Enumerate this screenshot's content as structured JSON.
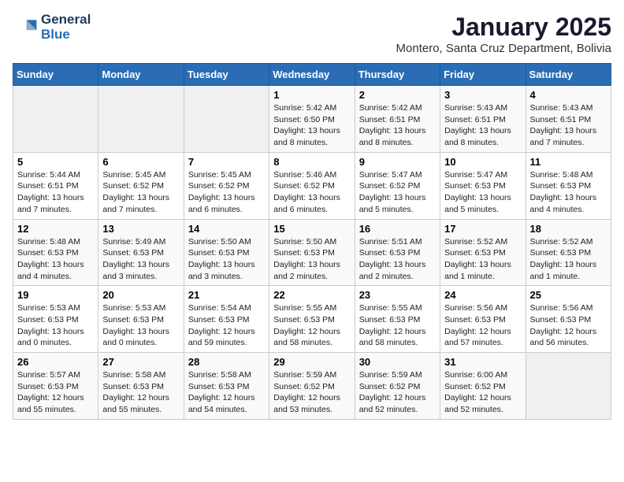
{
  "header": {
    "logo_line1": "General",
    "logo_line2": "Blue",
    "title": "January 2025",
    "subtitle": "Montero, Santa Cruz Department, Bolivia"
  },
  "weekdays": [
    "Sunday",
    "Monday",
    "Tuesday",
    "Wednesday",
    "Thursday",
    "Friday",
    "Saturday"
  ],
  "weeks": [
    [
      {
        "day": "",
        "info": ""
      },
      {
        "day": "",
        "info": ""
      },
      {
        "day": "",
        "info": ""
      },
      {
        "day": "1",
        "info": "Sunrise: 5:42 AM\nSunset: 6:50 PM\nDaylight: 13 hours and 8 minutes."
      },
      {
        "day": "2",
        "info": "Sunrise: 5:42 AM\nSunset: 6:51 PM\nDaylight: 13 hours and 8 minutes."
      },
      {
        "day": "3",
        "info": "Sunrise: 5:43 AM\nSunset: 6:51 PM\nDaylight: 13 hours and 8 minutes."
      },
      {
        "day": "4",
        "info": "Sunrise: 5:43 AM\nSunset: 6:51 PM\nDaylight: 13 hours and 7 minutes."
      }
    ],
    [
      {
        "day": "5",
        "info": "Sunrise: 5:44 AM\nSunset: 6:51 PM\nDaylight: 13 hours and 7 minutes."
      },
      {
        "day": "6",
        "info": "Sunrise: 5:45 AM\nSunset: 6:52 PM\nDaylight: 13 hours and 7 minutes."
      },
      {
        "day": "7",
        "info": "Sunrise: 5:45 AM\nSunset: 6:52 PM\nDaylight: 13 hours and 6 minutes."
      },
      {
        "day": "8",
        "info": "Sunrise: 5:46 AM\nSunset: 6:52 PM\nDaylight: 13 hours and 6 minutes."
      },
      {
        "day": "9",
        "info": "Sunrise: 5:47 AM\nSunset: 6:52 PM\nDaylight: 13 hours and 5 minutes."
      },
      {
        "day": "10",
        "info": "Sunrise: 5:47 AM\nSunset: 6:53 PM\nDaylight: 13 hours and 5 minutes."
      },
      {
        "day": "11",
        "info": "Sunrise: 5:48 AM\nSunset: 6:53 PM\nDaylight: 13 hours and 4 minutes."
      }
    ],
    [
      {
        "day": "12",
        "info": "Sunrise: 5:48 AM\nSunset: 6:53 PM\nDaylight: 13 hours and 4 minutes."
      },
      {
        "day": "13",
        "info": "Sunrise: 5:49 AM\nSunset: 6:53 PM\nDaylight: 13 hours and 3 minutes."
      },
      {
        "day": "14",
        "info": "Sunrise: 5:50 AM\nSunset: 6:53 PM\nDaylight: 13 hours and 3 minutes."
      },
      {
        "day": "15",
        "info": "Sunrise: 5:50 AM\nSunset: 6:53 PM\nDaylight: 13 hours and 2 minutes."
      },
      {
        "day": "16",
        "info": "Sunrise: 5:51 AM\nSunset: 6:53 PM\nDaylight: 13 hours and 2 minutes."
      },
      {
        "day": "17",
        "info": "Sunrise: 5:52 AM\nSunset: 6:53 PM\nDaylight: 13 hours and 1 minute."
      },
      {
        "day": "18",
        "info": "Sunrise: 5:52 AM\nSunset: 6:53 PM\nDaylight: 13 hours and 1 minute."
      }
    ],
    [
      {
        "day": "19",
        "info": "Sunrise: 5:53 AM\nSunset: 6:53 PM\nDaylight: 13 hours and 0 minutes."
      },
      {
        "day": "20",
        "info": "Sunrise: 5:53 AM\nSunset: 6:53 PM\nDaylight: 13 hours and 0 minutes."
      },
      {
        "day": "21",
        "info": "Sunrise: 5:54 AM\nSunset: 6:53 PM\nDaylight: 12 hours and 59 minutes."
      },
      {
        "day": "22",
        "info": "Sunrise: 5:55 AM\nSunset: 6:53 PM\nDaylight: 12 hours and 58 minutes."
      },
      {
        "day": "23",
        "info": "Sunrise: 5:55 AM\nSunset: 6:53 PM\nDaylight: 12 hours and 58 minutes."
      },
      {
        "day": "24",
        "info": "Sunrise: 5:56 AM\nSunset: 6:53 PM\nDaylight: 12 hours and 57 minutes."
      },
      {
        "day": "25",
        "info": "Sunrise: 5:56 AM\nSunset: 6:53 PM\nDaylight: 12 hours and 56 minutes."
      }
    ],
    [
      {
        "day": "26",
        "info": "Sunrise: 5:57 AM\nSunset: 6:53 PM\nDaylight: 12 hours and 55 minutes."
      },
      {
        "day": "27",
        "info": "Sunrise: 5:58 AM\nSunset: 6:53 PM\nDaylight: 12 hours and 55 minutes."
      },
      {
        "day": "28",
        "info": "Sunrise: 5:58 AM\nSunset: 6:53 PM\nDaylight: 12 hours and 54 minutes."
      },
      {
        "day": "29",
        "info": "Sunrise: 5:59 AM\nSunset: 6:52 PM\nDaylight: 12 hours and 53 minutes."
      },
      {
        "day": "30",
        "info": "Sunrise: 5:59 AM\nSunset: 6:52 PM\nDaylight: 12 hours and 52 minutes."
      },
      {
        "day": "31",
        "info": "Sunrise: 6:00 AM\nSunset: 6:52 PM\nDaylight: 12 hours and 52 minutes."
      },
      {
        "day": "",
        "info": ""
      }
    ]
  ]
}
